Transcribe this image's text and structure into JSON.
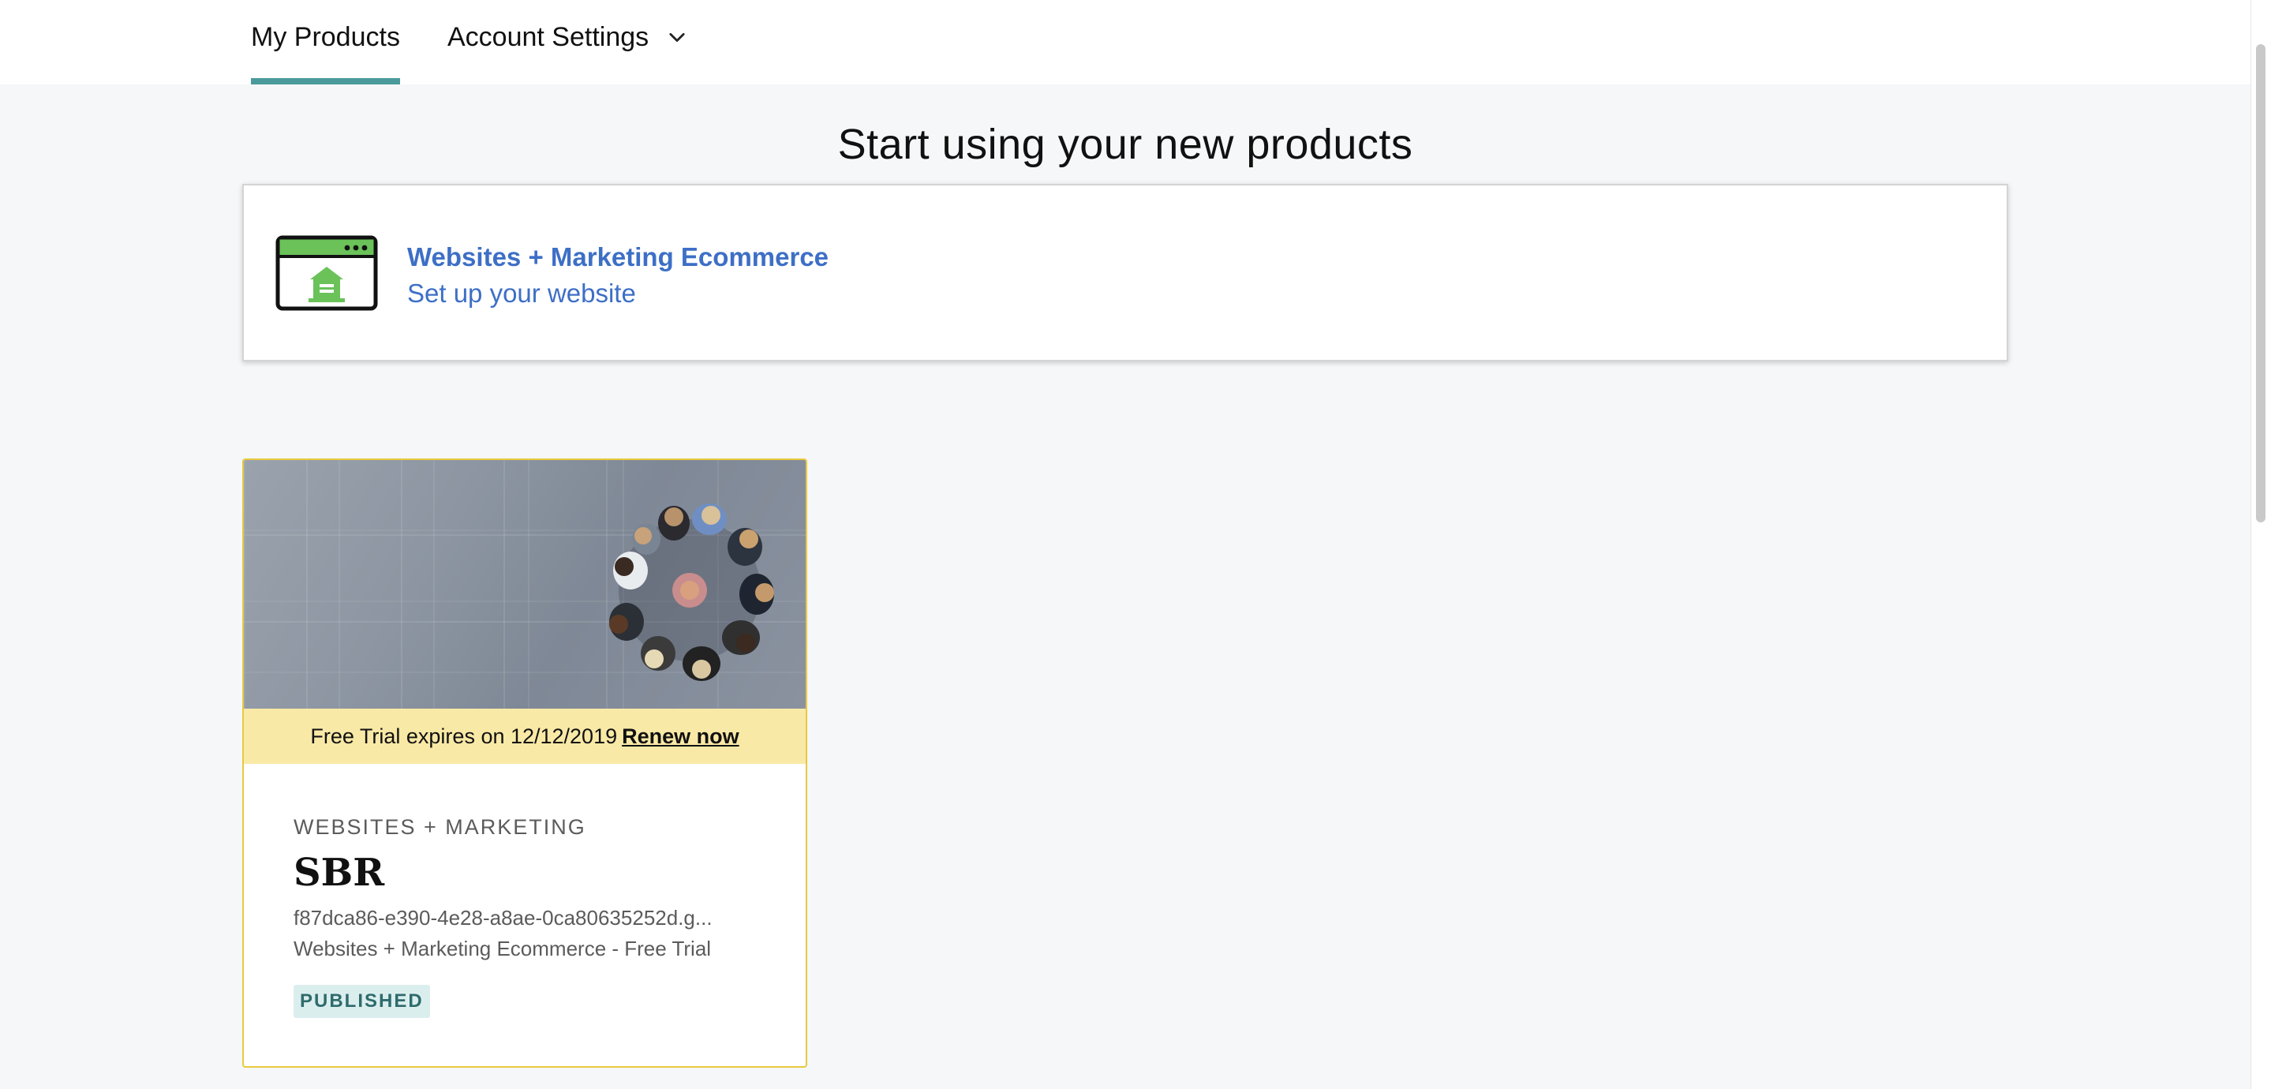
{
  "nav": {
    "tabs": [
      {
        "label": "My Products",
        "active": true
      },
      {
        "label": "Account Settings",
        "has_dropdown": true
      }
    ],
    "active_tab_color": "#4a9a9b"
  },
  "heading": "Start using your new products",
  "setup": {
    "icon": "website-store-icon",
    "title": "Websites + Marketing Ecommerce",
    "subtitle": "Set up your website",
    "link_color": "#3d6fc6"
  },
  "product": {
    "image": "team-hands-together-photo",
    "trial_text": "Free Trial expires on 12/12/2019",
    "renew_label": "Renew now",
    "category": "WEBSITES + MARKETING",
    "name": "SBR",
    "domain": "f87dca86-e390-4e28-a8ae-0ca80635252d.g...",
    "plan": "Websites + Marketing Ecommerce - Free Trial",
    "status": "PUBLISHED",
    "border_color": "#e8c93e",
    "banner_color": "#f9e9a6"
  }
}
